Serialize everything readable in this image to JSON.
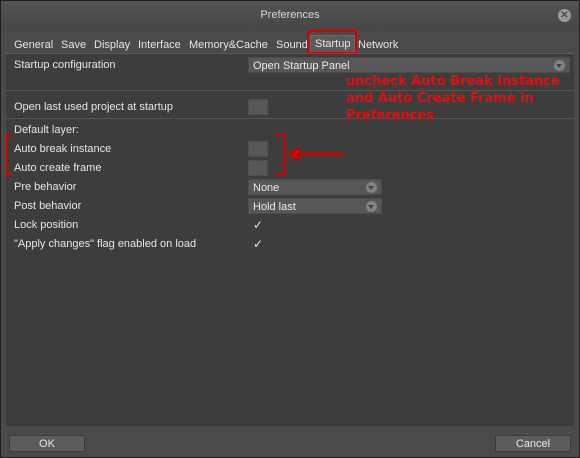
{
  "window": {
    "title": "Preferences"
  },
  "tabs": [
    {
      "label": "General"
    },
    {
      "label": "Save"
    },
    {
      "label": "Display"
    },
    {
      "label": "Interface"
    },
    {
      "label": "Memory&Cache"
    },
    {
      "label": "Sound"
    },
    {
      "label": "Startup"
    },
    {
      "label": "Network"
    }
  ],
  "active_tab": "Startup",
  "settings": {
    "startup_configuration": {
      "label": "Startup configuration",
      "value": "Open Startup Panel"
    },
    "open_last_project": {
      "label": "Open last used project at startup",
      "checked": false
    },
    "default_layer": {
      "label": "Default layer:"
    },
    "auto_break_instance": {
      "label": "Auto break instance",
      "checked": false
    },
    "auto_create_frame": {
      "label": "Auto create frame",
      "checked": false
    },
    "pre_behavior": {
      "label": "Pre behavior",
      "value": "None"
    },
    "post_behavior": {
      "label": "Post behavior",
      "value": "Hold last"
    },
    "lock_position": {
      "label": "Lock position",
      "checked": true
    },
    "apply_changes_flag": {
      "label": "\"Apply changes\" flag enabled on load",
      "checked": true
    }
  },
  "annotation": {
    "text": "uncheck Auto Break Instance and Auto Create Frame in Preferences",
    "color": "#e01010"
  },
  "buttons": {
    "ok": "OK",
    "cancel": "Cancel"
  },
  "colors": {
    "background": "#4a4a4a",
    "panel": "#3d3d3d",
    "highlight": "#d40000"
  }
}
